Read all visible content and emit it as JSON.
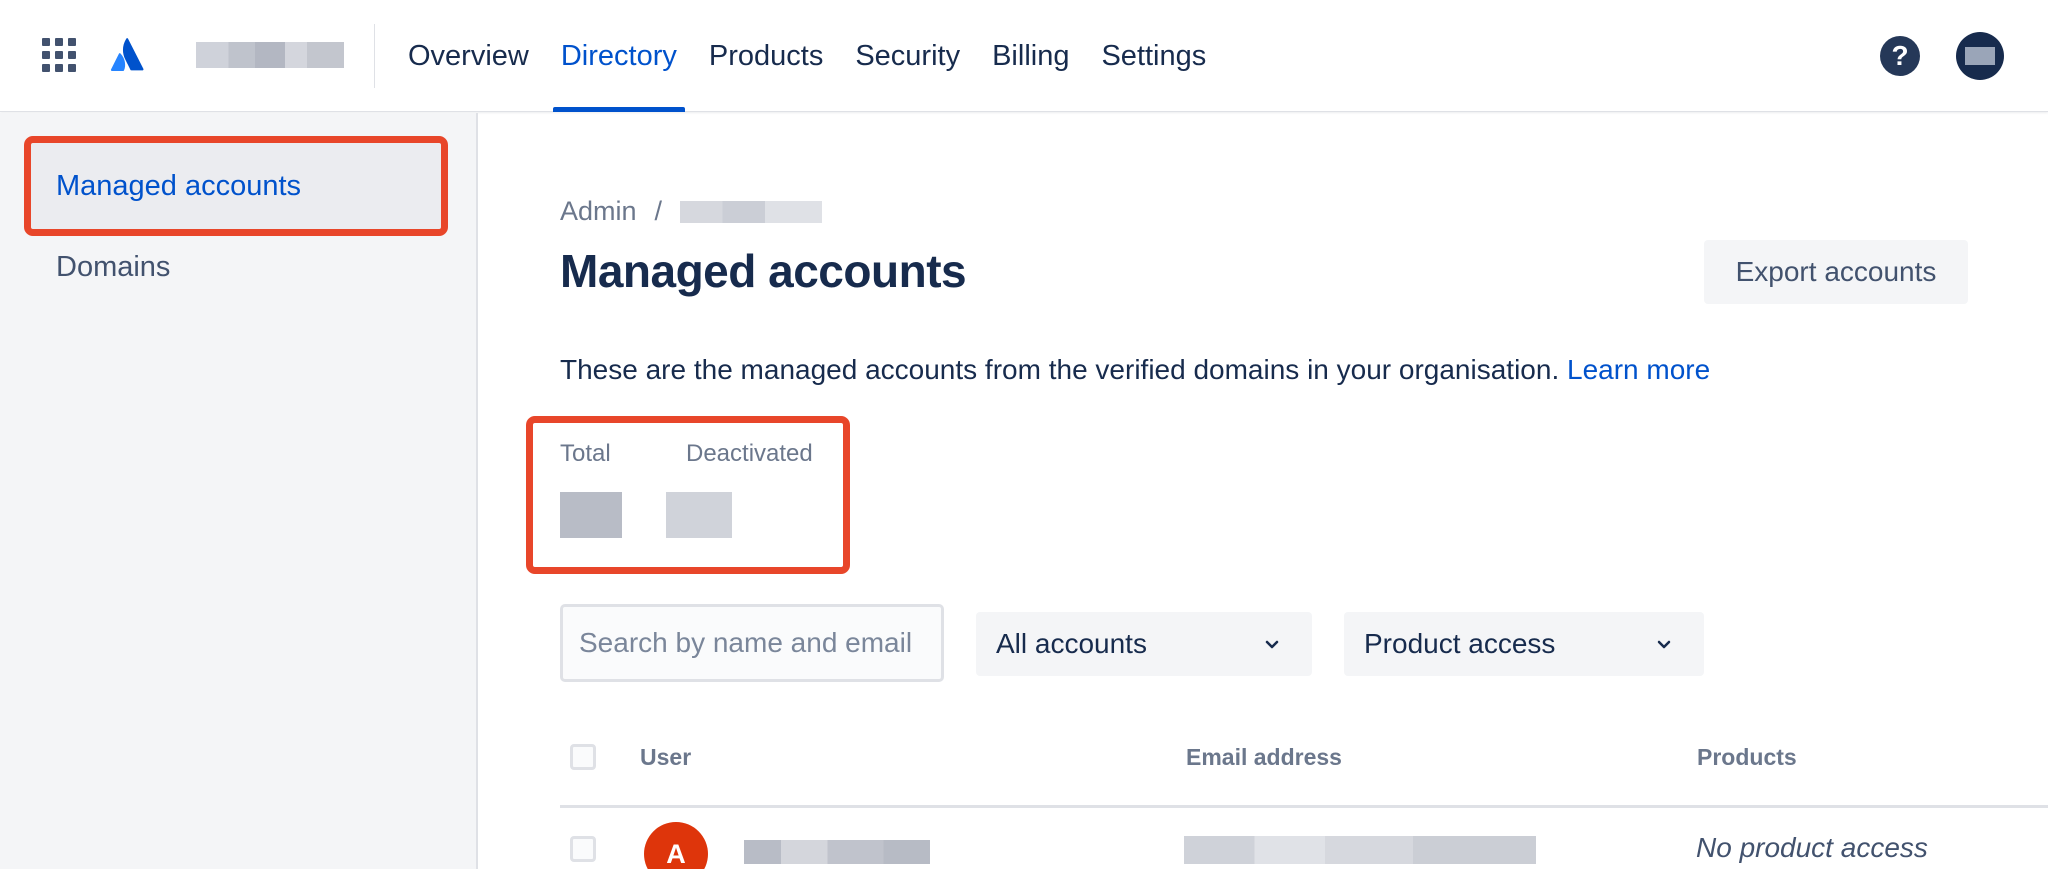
{
  "nav": {
    "items": [
      {
        "label": "Overview"
      },
      {
        "label": "Directory"
      },
      {
        "label": "Products"
      },
      {
        "label": "Security"
      },
      {
        "label": "Billing"
      },
      {
        "label": "Settings"
      }
    ],
    "active": "Directory"
  },
  "help": {
    "glyph": "?"
  },
  "sidebar": {
    "items": [
      {
        "label": "Managed accounts",
        "active": true
      },
      {
        "label": "Domains",
        "active": false
      }
    ]
  },
  "breadcrumb": {
    "root": "Admin",
    "separator": "/"
  },
  "page": {
    "title": "Managed accounts",
    "export_label": "Export accounts",
    "description": "These are the managed accounts from the verified domains in your organisation.",
    "learn_more": "Learn more"
  },
  "stats": {
    "total_label": "Total",
    "deactivated_label": "Deactivated"
  },
  "filters": {
    "search_placeholder": "Search by name and email",
    "accounts_select": "All accounts",
    "product_select": "Product access"
  },
  "table": {
    "columns": [
      "User",
      "Email address",
      "Products"
    ],
    "rows": [
      {
        "avatar_initial": "A",
        "products": "No product access"
      }
    ]
  },
  "colors": {
    "accent": "#0052CC",
    "highlight": "#E8462A",
    "avatar": "#DE350B"
  },
  "icons": [
    "app-switcher-icon",
    "atlassian-logo-icon",
    "help-icon",
    "chevron-down-icon"
  ]
}
